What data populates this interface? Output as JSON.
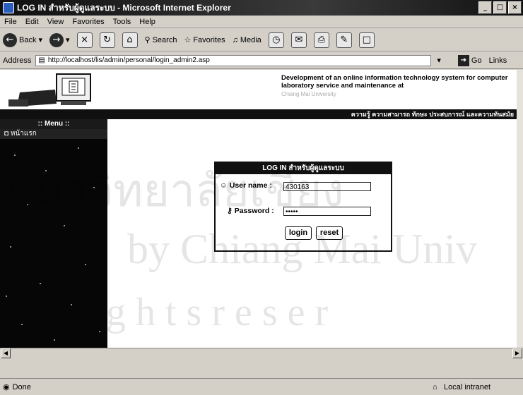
{
  "window": {
    "title": "LOG IN สำหรับผู้ดูแลระบบ - Microsoft Internet Explorer",
    "buttons": [
      "_",
      "□",
      "×"
    ]
  },
  "menubar": [
    "File",
    "Edit",
    "View",
    "Favorites",
    "Tools",
    "Help"
  ],
  "toolbar": {
    "back": "Back",
    "search": "Search",
    "favorites": "Favorites",
    "media": "Media"
  },
  "address": {
    "label": "Address",
    "url": "http://localhost/lis/admin/personal/login_admin2.asp",
    "go": "Go",
    "links": "Links"
  },
  "banner": {
    "title": "Development of an online information technology system for computer laboratory service and maintenance at",
    "subtitle": "Chiang Mai University",
    "strip": "ความรู้ ความสามารถ ทักษะ ประสบการณ์ และความทันสมัย"
  },
  "sidebar": {
    "menu_label": ":: Menu ::",
    "home": "หน้าแรก"
  },
  "login": {
    "header": "LOG IN สำหรับผู้ดูแลระบบ",
    "username_label": "User name :",
    "username_value": "430163",
    "password_label": "Password :",
    "password_value": "•••••",
    "login_button": "login",
    "reset_button": "reset"
  },
  "watermark": {
    "line1": "มหาวิทยาลัยเชียง",
    "line2": "by Chiang Mai Univ",
    "line3": "g h t s   r e s e r"
  },
  "status": {
    "left": "Done",
    "right": "Local intranet"
  }
}
